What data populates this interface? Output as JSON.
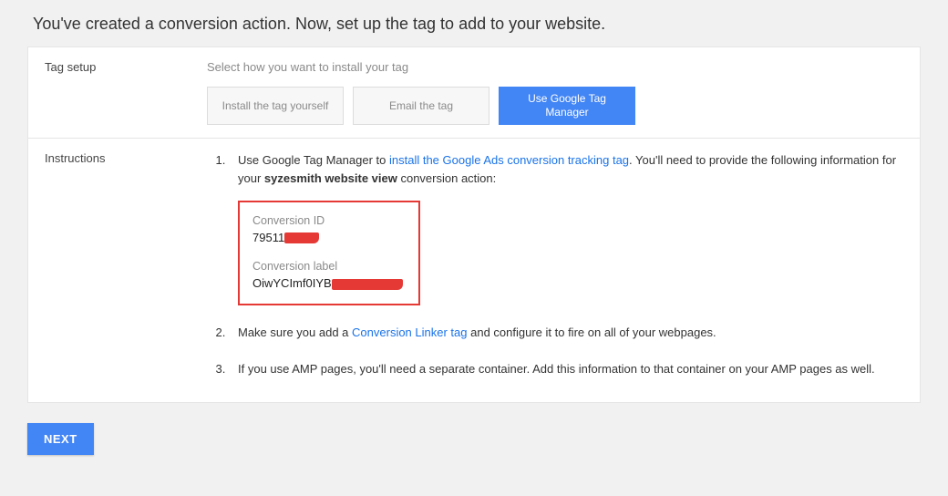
{
  "heading": "You've created a conversion action. Now, set up the tag to add to your website.",
  "section1": {
    "label": "Tag setup",
    "helper": "Select how you want to install your tag",
    "tabs": {
      "install": "Install the tag yourself",
      "email": "Email the tag",
      "gtm": "Use Google Tag Manager"
    }
  },
  "section2": {
    "label": "Instructions",
    "step1_a": "Use Google Tag Manager to ",
    "step1_link": "install the Google Ads conversion tracking tag",
    "step1_b": ". You'll need to provide the following information for your ",
    "step1_bold": "syzesmith website view",
    "step1_c": " conversion action:",
    "conv_id_label": "Conversion ID",
    "conv_id_value": "79511",
    "conv_label_label": "Conversion label",
    "conv_label_value": "OiwYCImf0IYB",
    "step2_a": "Make sure you add a ",
    "step2_link": "Conversion Linker tag",
    "step2_b": " and configure it to fire on all of your webpages.",
    "step3": "If you use AMP pages, you'll need a separate container. Add this information to that container on your AMP pages as well."
  },
  "next": "NEXT"
}
